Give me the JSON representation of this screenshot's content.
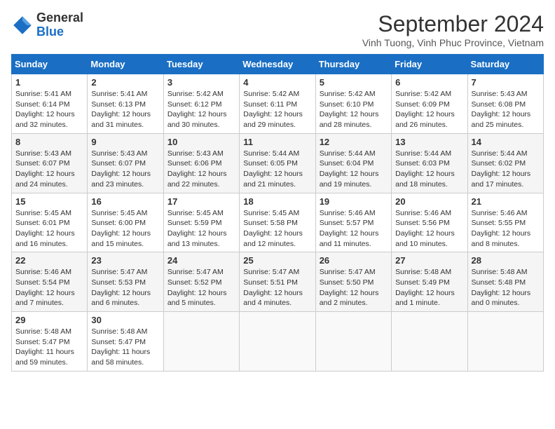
{
  "header": {
    "logo_general": "General",
    "logo_blue": "Blue",
    "month_title": "September 2024",
    "subtitle": "Vinh Tuong, Vinh Phuc Province, Vietnam"
  },
  "weekdays": [
    "Sunday",
    "Monday",
    "Tuesday",
    "Wednesday",
    "Thursday",
    "Friday",
    "Saturday"
  ],
  "weeks": [
    [
      {
        "day": "1",
        "sunrise": "5:41 AM",
        "sunset": "6:14 PM",
        "daylight": "12 hours and 32 minutes."
      },
      {
        "day": "2",
        "sunrise": "5:41 AM",
        "sunset": "6:13 PM",
        "daylight": "12 hours and 31 minutes."
      },
      {
        "day": "3",
        "sunrise": "5:42 AM",
        "sunset": "6:12 PM",
        "daylight": "12 hours and 30 minutes."
      },
      {
        "day": "4",
        "sunrise": "5:42 AM",
        "sunset": "6:11 PM",
        "daylight": "12 hours and 29 minutes."
      },
      {
        "day": "5",
        "sunrise": "5:42 AM",
        "sunset": "6:10 PM",
        "daylight": "12 hours and 28 minutes."
      },
      {
        "day": "6",
        "sunrise": "5:42 AM",
        "sunset": "6:09 PM",
        "daylight": "12 hours and 26 minutes."
      },
      {
        "day": "7",
        "sunrise": "5:43 AM",
        "sunset": "6:08 PM",
        "daylight": "12 hours and 25 minutes."
      }
    ],
    [
      {
        "day": "8",
        "sunrise": "5:43 AM",
        "sunset": "6:07 PM",
        "daylight": "12 hours and 24 minutes."
      },
      {
        "day": "9",
        "sunrise": "5:43 AM",
        "sunset": "6:07 PM",
        "daylight": "12 hours and 23 minutes."
      },
      {
        "day": "10",
        "sunrise": "5:43 AM",
        "sunset": "6:06 PM",
        "daylight": "12 hours and 22 minutes."
      },
      {
        "day": "11",
        "sunrise": "5:44 AM",
        "sunset": "6:05 PM",
        "daylight": "12 hours and 21 minutes."
      },
      {
        "day": "12",
        "sunrise": "5:44 AM",
        "sunset": "6:04 PM",
        "daylight": "12 hours and 19 minutes."
      },
      {
        "day": "13",
        "sunrise": "5:44 AM",
        "sunset": "6:03 PM",
        "daylight": "12 hours and 18 minutes."
      },
      {
        "day": "14",
        "sunrise": "5:44 AM",
        "sunset": "6:02 PM",
        "daylight": "12 hours and 17 minutes."
      }
    ],
    [
      {
        "day": "15",
        "sunrise": "5:45 AM",
        "sunset": "6:01 PM",
        "daylight": "12 hours and 16 minutes."
      },
      {
        "day": "16",
        "sunrise": "5:45 AM",
        "sunset": "6:00 PM",
        "daylight": "12 hours and 15 minutes."
      },
      {
        "day": "17",
        "sunrise": "5:45 AM",
        "sunset": "5:59 PM",
        "daylight": "12 hours and 13 minutes."
      },
      {
        "day": "18",
        "sunrise": "5:45 AM",
        "sunset": "5:58 PM",
        "daylight": "12 hours and 12 minutes."
      },
      {
        "day": "19",
        "sunrise": "5:46 AM",
        "sunset": "5:57 PM",
        "daylight": "12 hours and 11 minutes."
      },
      {
        "day": "20",
        "sunrise": "5:46 AM",
        "sunset": "5:56 PM",
        "daylight": "12 hours and 10 minutes."
      },
      {
        "day": "21",
        "sunrise": "5:46 AM",
        "sunset": "5:55 PM",
        "daylight": "12 hours and 8 minutes."
      }
    ],
    [
      {
        "day": "22",
        "sunrise": "5:46 AM",
        "sunset": "5:54 PM",
        "daylight": "12 hours and 7 minutes."
      },
      {
        "day": "23",
        "sunrise": "5:47 AM",
        "sunset": "5:53 PM",
        "daylight": "12 hours and 6 minutes."
      },
      {
        "day": "24",
        "sunrise": "5:47 AM",
        "sunset": "5:52 PM",
        "daylight": "12 hours and 5 minutes."
      },
      {
        "day": "25",
        "sunrise": "5:47 AM",
        "sunset": "5:51 PM",
        "daylight": "12 hours and 4 minutes."
      },
      {
        "day": "26",
        "sunrise": "5:47 AM",
        "sunset": "5:50 PM",
        "daylight": "12 hours and 2 minutes."
      },
      {
        "day": "27",
        "sunrise": "5:48 AM",
        "sunset": "5:49 PM",
        "daylight": "12 hours and 1 minute."
      },
      {
        "day": "28",
        "sunrise": "5:48 AM",
        "sunset": "5:48 PM",
        "daylight": "12 hours and 0 minutes."
      }
    ],
    [
      {
        "day": "29",
        "sunrise": "5:48 AM",
        "sunset": "5:47 PM",
        "daylight": "11 hours and 59 minutes."
      },
      {
        "day": "30",
        "sunrise": "5:48 AM",
        "sunset": "5:47 PM",
        "daylight": "11 hours and 58 minutes."
      },
      null,
      null,
      null,
      null,
      null
    ]
  ]
}
